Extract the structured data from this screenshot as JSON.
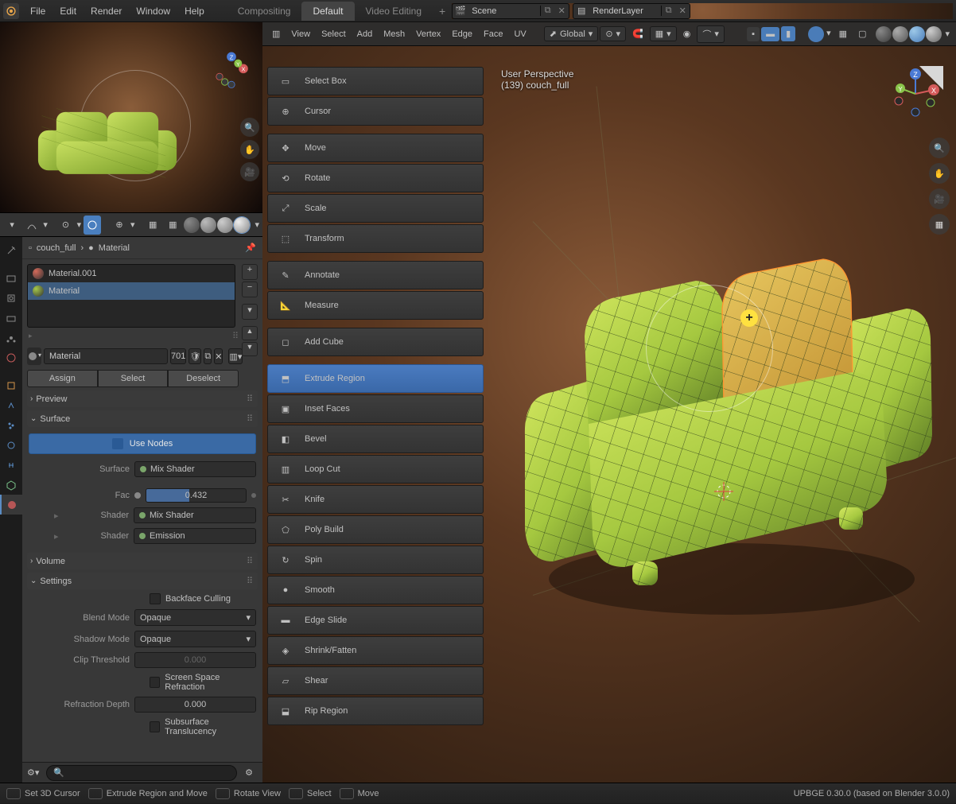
{
  "topbar": {
    "menus": [
      "File",
      "Edit",
      "Render",
      "Window",
      "Help"
    ],
    "workspaces": [
      "Compositing",
      "Default",
      "Video Editing"
    ],
    "active_workspace": "Default",
    "scene": "Scene",
    "viewlayer": "RenderLayer"
  },
  "viewport_header": {
    "menus": [
      "View",
      "Select",
      "Add",
      "Mesh",
      "Vertex",
      "Edge",
      "Face",
      "UV"
    ],
    "orientation": "Global"
  },
  "viewport_info": {
    "line1": "User Perspective",
    "line2": "(139) couch_full"
  },
  "tools": [
    {
      "id": "select-box",
      "label": "Select Box",
      "icon": "select"
    },
    {
      "id": "cursor",
      "label": "Cursor",
      "icon": "cursor"
    },
    {
      "id": "gap"
    },
    {
      "id": "move",
      "label": "Move",
      "icon": "move"
    },
    {
      "id": "rotate",
      "label": "Rotate",
      "icon": "rotate"
    },
    {
      "id": "scale",
      "label": "Scale",
      "icon": "scale"
    },
    {
      "id": "transform",
      "label": "Transform",
      "icon": "transform"
    },
    {
      "id": "gap"
    },
    {
      "id": "annotate",
      "label": "Annotate",
      "icon": "pencil"
    },
    {
      "id": "measure",
      "label": "Measure",
      "icon": "ruler"
    },
    {
      "id": "gap"
    },
    {
      "id": "add-cube",
      "label": "Add Cube",
      "icon": "cube"
    },
    {
      "id": "gap"
    },
    {
      "id": "extrude-region",
      "label": "Extrude Region",
      "icon": "extrude",
      "active": true
    },
    {
      "id": "inset-faces",
      "label": "Inset Faces",
      "icon": "inset"
    },
    {
      "id": "bevel",
      "label": "Bevel",
      "icon": "bevel"
    },
    {
      "id": "loop-cut",
      "label": "Loop Cut",
      "icon": "loop"
    },
    {
      "id": "knife",
      "label": "Knife",
      "icon": "knife"
    },
    {
      "id": "poly-build",
      "label": "Poly Build",
      "icon": "poly"
    },
    {
      "id": "spin",
      "label": "Spin",
      "icon": "spin"
    },
    {
      "id": "smooth",
      "label": "Smooth",
      "icon": "smooth"
    },
    {
      "id": "edge-slide",
      "label": "Edge Slide",
      "icon": "edge"
    },
    {
      "id": "shrink-fatten",
      "label": "Shrink/Fatten",
      "icon": "shrink"
    },
    {
      "id": "shear",
      "label": "Shear",
      "icon": "shear"
    },
    {
      "id": "rip-region",
      "label": "Rip Region",
      "icon": "rip"
    }
  ],
  "breadcrumb": {
    "object": "couch_full",
    "material": "Material"
  },
  "materials": [
    {
      "name": "Material.001",
      "swatch": "#d46a5a"
    },
    {
      "name": "Material",
      "swatch": "#a5c84a",
      "selected": true
    }
  ],
  "material_header": {
    "name": "Material",
    "count": "701"
  },
  "assign_buttons": [
    "Assign",
    "Select",
    "Deselect"
  ],
  "panels": {
    "preview": "Preview",
    "surface": "Surface",
    "volume": "Volume",
    "settings": "Settings"
  },
  "use_nodes": "Use Nodes",
  "surface_rows": {
    "surface_label": "Surface",
    "surface_value": "Mix Shader",
    "fac_label": "Fac",
    "fac_value": "0.432",
    "fac_ratio": 0.432,
    "shader1_label": "Shader",
    "shader1_value": "Mix Shader",
    "shader2_label": "Shader",
    "shader2_value": "Emission"
  },
  "settings_rows": {
    "backface": "Backface Culling",
    "blend_label": "Blend Mode",
    "blend_value": "Opaque",
    "shadow_label": "Shadow Mode",
    "shadow_value": "Opaque",
    "clip_label": "Clip Threshold",
    "clip_value": "0.000",
    "ssr": "Screen Space Refraction",
    "refr_label": "Refraction Depth",
    "refr_value": "0.000",
    "sss": "Subsurface Translucency"
  },
  "status": {
    "items": [
      "Set 3D Cursor",
      "Extrude Region and Move",
      "Rotate View",
      "Select",
      "Move"
    ],
    "version": "UPBGE 0.30.0 (based on Blender 3.0.0)"
  }
}
